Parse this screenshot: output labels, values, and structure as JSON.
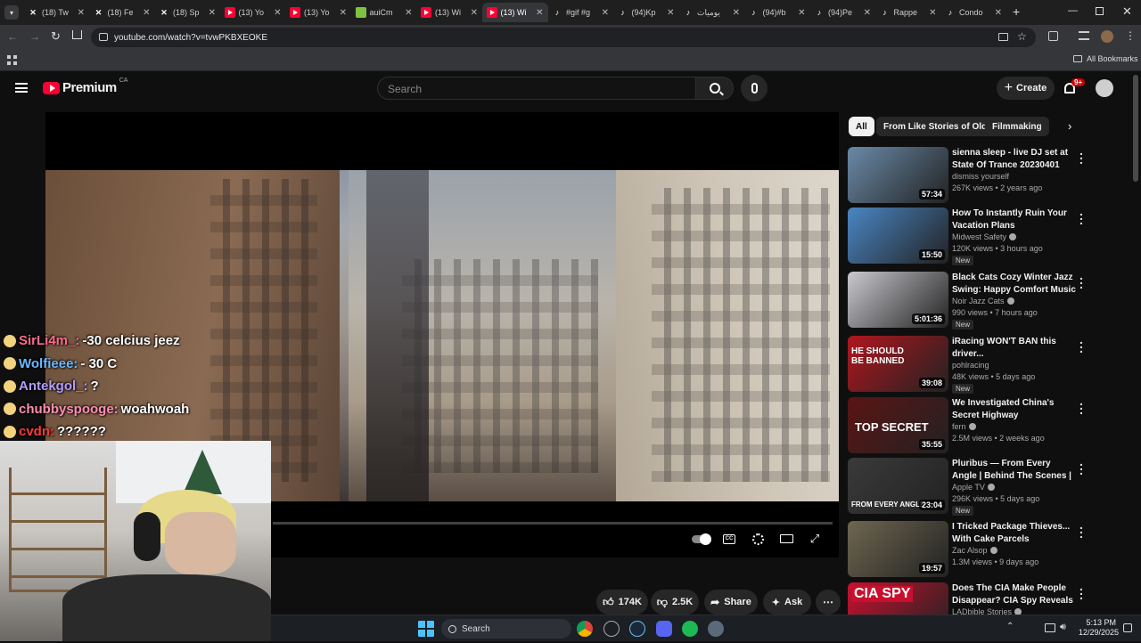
{
  "tabs": [
    {
      "label": "(18) Tw",
      "icon": "x-icon"
    },
    {
      "label": "(18) Fe",
      "icon": "x-icon"
    },
    {
      "label": "(18) Sp",
      "icon": "x-icon"
    },
    {
      "label": "(13) Yo",
      "icon": "youtube-icon"
    },
    {
      "label": "(13) Yo",
      "icon": "youtube-icon"
    },
    {
      "label": "auiCm",
      "icon": "globe-icon"
    },
    {
      "label": "(13) Wi",
      "icon": "youtube-icon"
    },
    {
      "label": "(13) Wi",
      "icon": "youtube-icon",
      "active": true
    },
    {
      "label": "#gif #g",
      "icon": "tiktok-icon"
    },
    {
      "label": "(94)Kp",
      "icon": "tiktok-icon"
    },
    {
      "label": "يوميات",
      "icon": "tiktok-icon"
    },
    {
      "label": "(94)#b",
      "icon": "tiktok-icon"
    },
    {
      "label": "(94)Pe",
      "icon": "tiktok-icon"
    },
    {
      "label": "Rappe",
      "icon": "tiktok-icon"
    },
    {
      "label": "Condo",
      "icon": "tiktok-icon"
    }
  ],
  "address": "youtube.com/watch?v=tvwPKBXEOKE",
  "bookmarks_label": "All Bookmarks",
  "yt": {
    "logo": "Premium",
    "country": "CA",
    "search_placeholder": "Search",
    "create_label": "Create",
    "notif_count": "9+"
  },
  "chat": [
    {
      "user": "SirLi4m_:",
      "msg": "-30 celcius jeez",
      "color": "#ff6b8a"
    },
    {
      "user": "Wolfieee:",
      "msg": "- 30 C",
      "color": "#6ab7ff"
    },
    {
      "user": "Antekgol_:",
      "msg": "?",
      "color": "#b39cff"
    },
    {
      "user": "chubbyspooge:",
      "msg": "woahwoah",
      "color": "#ff8fb1"
    },
    {
      "user": "cvdn:",
      "msg": "??????",
      "color": "#ff3b3b"
    }
  ],
  "actions": {
    "likes": "174K",
    "dislikes": "2.5K",
    "share": "Share",
    "ask": "Ask"
  },
  "chips": [
    "All",
    "From Like Stories of Old",
    "Filmmaking"
  ],
  "recommendations": [
    {
      "title": "sienna sleep - live DJ set at State Of Trance 20230401",
      "channel": "dismiss yourself",
      "meta": "267K views • 2 years ago",
      "duration": "57:34",
      "new": false,
      "verified": false,
      "thumb": "#6a8aa8"
    },
    {
      "title": "How To Instantly Ruin Your Vacation Plans",
      "channel": "Midwest Safety",
      "meta": "120K views • 3 hours ago",
      "duration": "15:50",
      "new": true,
      "verified": true,
      "thumb": "#4a86c4"
    },
    {
      "title": "Black Cats Cozy Winter Jazz Swing: Happy Comfort Music ...",
      "channel": "Noir Jazz Cats",
      "meta": "990 views • 7 hours ago",
      "duration": "5:01:36",
      "new": true,
      "verified": true,
      "thumb": "#c9c9cf"
    },
    {
      "title": "iRacing WON'T BAN this driver...",
      "channel": "pohlracing",
      "meta": "48K views • 5 days ago",
      "duration": "39:08",
      "new": true,
      "verified": false,
      "thumb": "#b0161e"
    },
    {
      "title": "We Investigated China's Secret Highway",
      "channel": "fern",
      "meta": "2.5M views • 2 weeks ago",
      "duration": "35:55",
      "new": false,
      "verified": true,
      "thumb": "#5b1414"
    },
    {
      "title": "Pluribus — From Every Angle | Behind The Scenes | Apple TV",
      "channel": "Apple TV",
      "meta": "296K views • 5 days ago",
      "duration": "23:04",
      "new": true,
      "verified": true,
      "thumb": "#3a3a3a"
    },
    {
      "title": "I Tricked Package Thieves... With Cake Parcels",
      "channel": "Zac Alsop",
      "meta": "1.3M views • 9 days ago",
      "duration": "19:57",
      "new": false,
      "verified": true,
      "thumb": "#6e6650"
    },
    {
      "title": "Does The CIA Make People Disappear? CIA Spy Reveals | ...",
      "channel": "LADbible Stories",
      "meta": "",
      "duration": "",
      "new": false,
      "verified": true,
      "thumb": "#c8102e"
    }
  ],
  "thumb_text": {
    "racing": "HE SHOULD BE BANNED",
    "china": "TOP SECRET",
    "pluribus": "FROM EVERY ANGLE",
    "cia": "CIA SPY"
  },
  "taskbar": {
    "search": "Search",
    "time": "5:13 PM",
    "date": "12/29/2025"
  }
}
